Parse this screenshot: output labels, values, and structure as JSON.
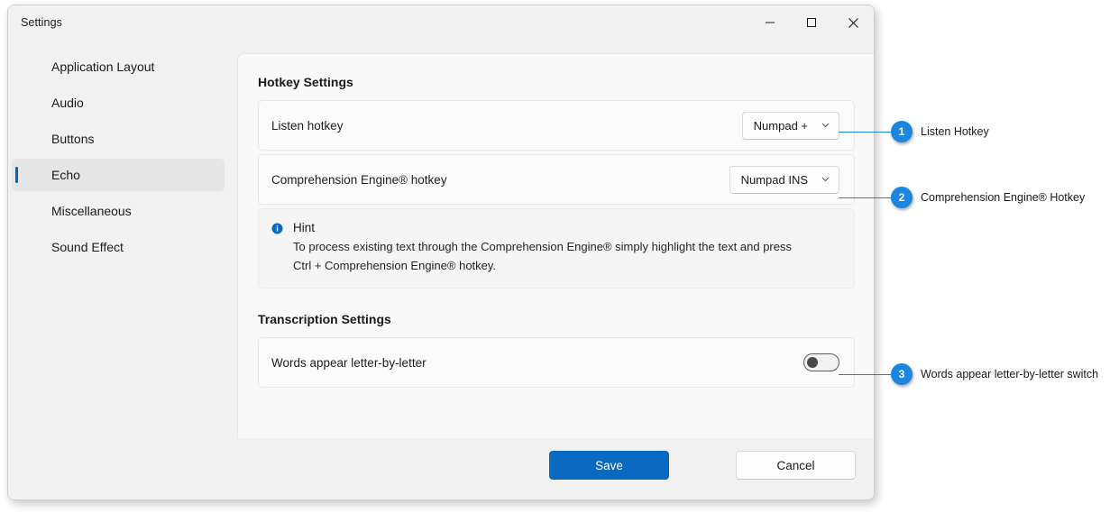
{
  "window": {
    "title": "Settings",
    "controls": [
      {
        "name": "minimize",
        "glyph": "minimize-icon"
      },
      {
        "name": "maximize",
        "glyph": "maximize-icon"
      },
      {
        "name": "close",
        "glyph": "close-icon"
      }
    ]
  },
  "sidebar": {
    "items": [
      {
        "label": "Application Layout",
        "selected": false
      },
      {
        "label": "Audio",
        "selected": false
      },
      {
        "label": "Buttons",
        "selected": false
      },
      {
        "label": "Echo",
        "selected": true
      },
      {
        "label": "Miscellaneous",
        "selected": false
      },
      {
        "label": "Sound Effect",
        "selected": false
      }
    ]
  },
  "main": {
    "hotkey_section_title": "Hotkey Settings",
    "rows": [
      {
        "label": "Listen hotkey",
        "control": "dropdown",
        "value": "Numpad +"
      },
      {
        "label": "Comprehension Engine® hotkey",
        "control": "dropdown",
        "value": "Numpad INS"
      }
    ],
    "hint": {
      "icon": "info-icon",
      "title": "Hint",
      "body": "To process existing text through the Comprehension Engine® simply highlight the text and press Ctrl + Comprehension Engine® hotkey."
    },
    "transcription_section_title": "Transcription Settings",
    "transcription_row": {
      "label": "Words appear letter-by-letter",
      "control": "toggle",
      "state": "off"
    }
  },
  "footer": {
    "save_label": "Save",
    "cancel_label": "Cancel"
  },
  "annotations": [
    {
      "number": "1",
      "label": "Listen Hotkey"
    },
    {
      "number": "2",
      "label": "Comprehension Engine® Hotkey"
    },
    {
      "number": "3",
      "label": "Words appear letter-by-letter switch"
    }
  ],
  "colors": {
    "accent": "#0a69c0",
    "annotation": "#1a86e0",
    "selected_indicator": "#0066cc",
    "window_chrome": "#f1f1f1",
    "panel": "#f9f9f9"
  }
}
